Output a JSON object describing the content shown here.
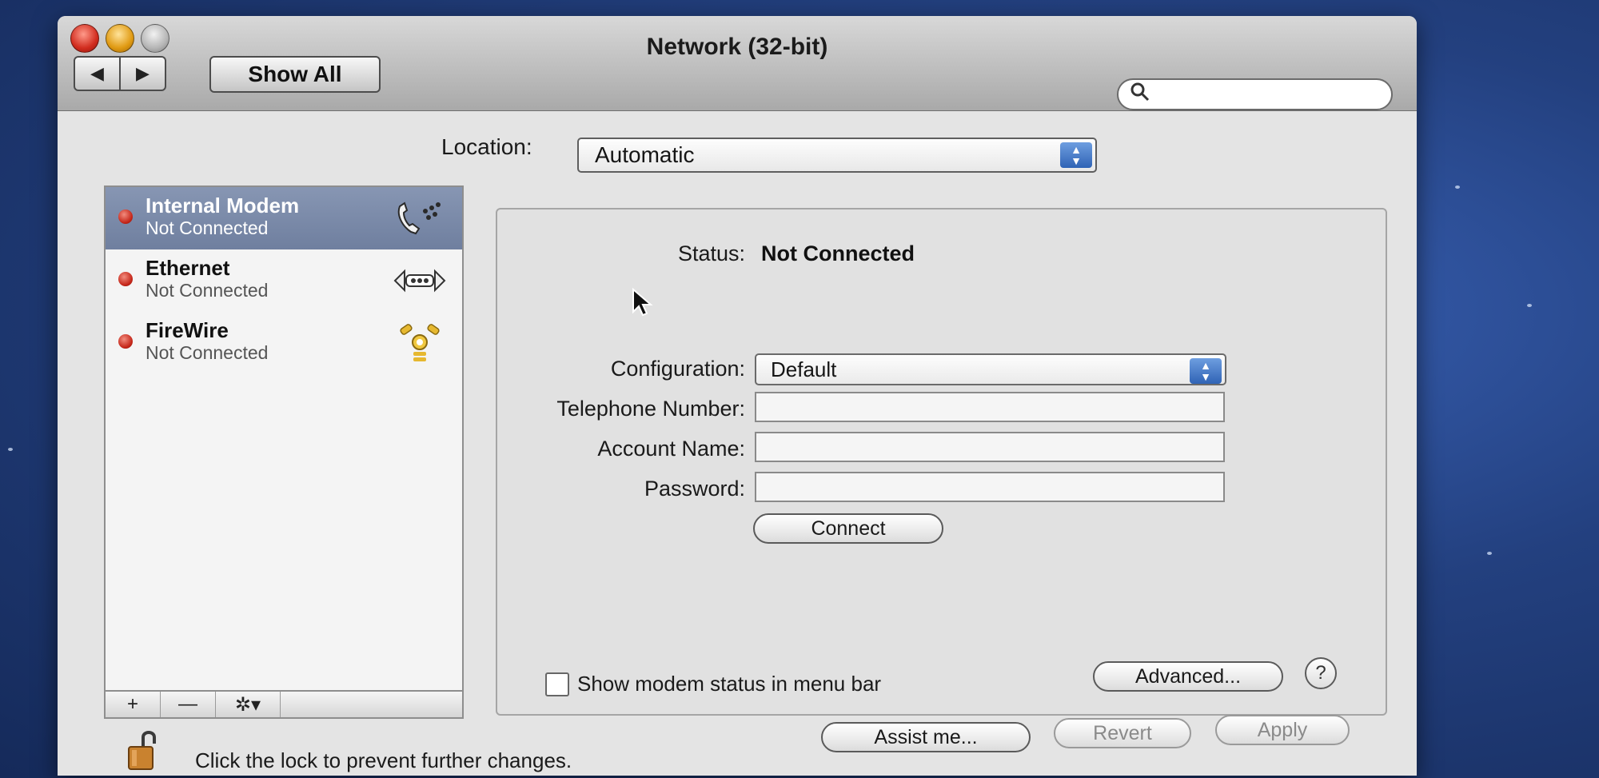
{
  "window": {
    "title": "Network (32-bit)"
  },
  "toolbar": {
    "back_glyph": "◀",
    "forward_glyph": "▶",
    "show_all_label": "Show All",
    "search_icon": "search-icon",
    "search_value": ""
  },
  "location": {
    "label": "Location:",
    "value": "Automatic"
  },
  "services": [
    {
      "name": "Internal Modem",
      "status": "Not Connected",
      "icon": "modem-icon",
      "selected": true
    },
    {
      "name": "Ethernet",
      "status": "Not Connected",
      "icon": "ethernet-icon",
      "selected": false
    },
    {
      "name": "FireWire",
      "status": "Not Connected",
      "icon": "firewire-icon",
      "selected": false
    }
  ],
  "list_tools": {
    "add": "+",
    "remove": "—",
    "action": "✲▾"
  },
  "detail": {
    "status_label": "Status:",
    "status_value": "Not Connected",
    "configuration_label": "Configuration:",
    "configuration_value": "Default",
    "telephone_label": "Telephone Number:",
    "telephone_value": "",
    "account_label": "Account Name:",
    "account_value": "",
    "password_label": "Password:",
    "password_value": "",
    "connect_label": "Connect",
    "menu_bar_checkbox_label": "Show modem status in menu bar",
    "menu_bar_checked": false,
    "advanced_label": "Advanced...",
    "help_label": "?"
  },
  "footer": {
    "lock_text": "Click the lock to prevent further changes.",
    "assist_label": "Assist me...",
    "revert_label": "Revert",
    "apply_label": "Apply"
  },
  "colors": {
    "selection": "#7a89a8",
    "status_dot": "#c42518",
    "stepper": "#3f74c6",
    "desktop": "#23407f"
  }
}
